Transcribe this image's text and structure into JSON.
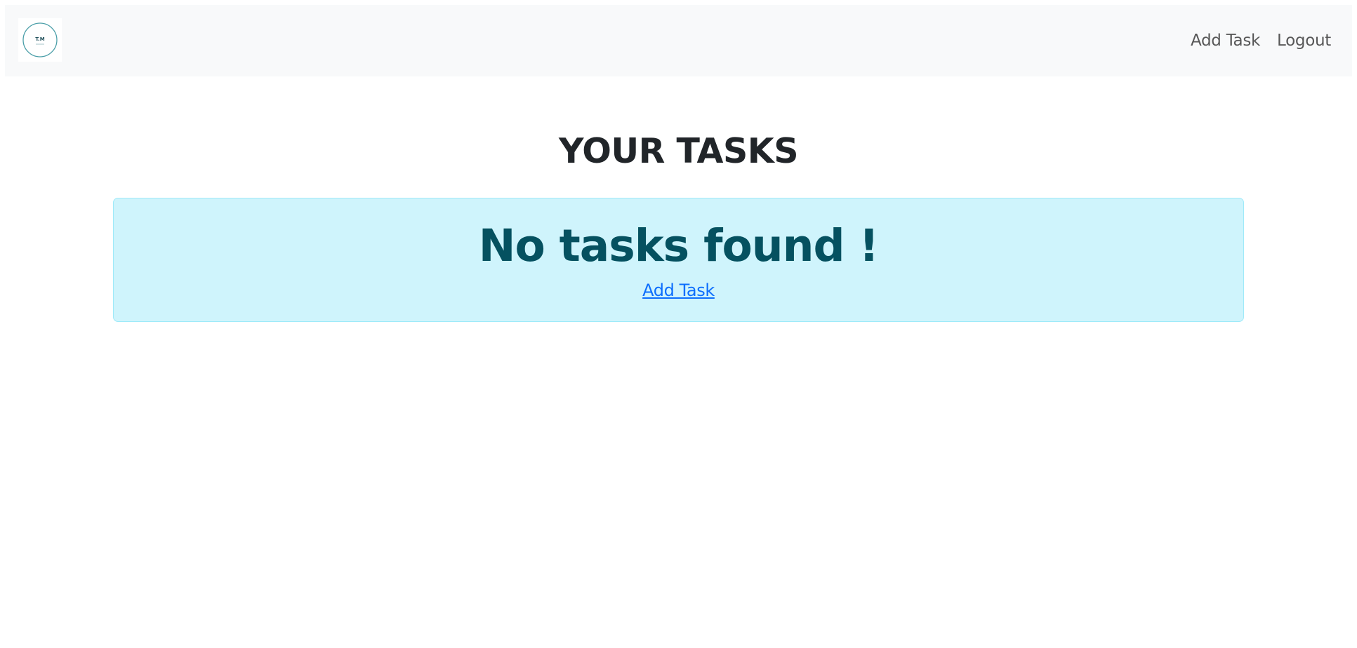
{
  "navbar": {
    "logo": {
      "icon": "circle-logo-icon",
      "text": "T.M"
    },
    "links": [
      {
        "label": "Add Task"
      },
      {
        "label": "Logout"
      }
    ]
  },
  "main": {
    "title": "YOUR TASKS",
    "alert": {
      "heading": "No tasks found !",
      "link_label": "Add Task"
    }
  },
  "colors": {
    "navbar_bg": "#f8f9fa",
    "alert_bg": "#cff4fc",
    "alert_border": "#9eeaf9",
    "alert_text": "#055160",
    "link": "#0d6efd",
    "logo_ring": "#4a9ea8"
  }
}
